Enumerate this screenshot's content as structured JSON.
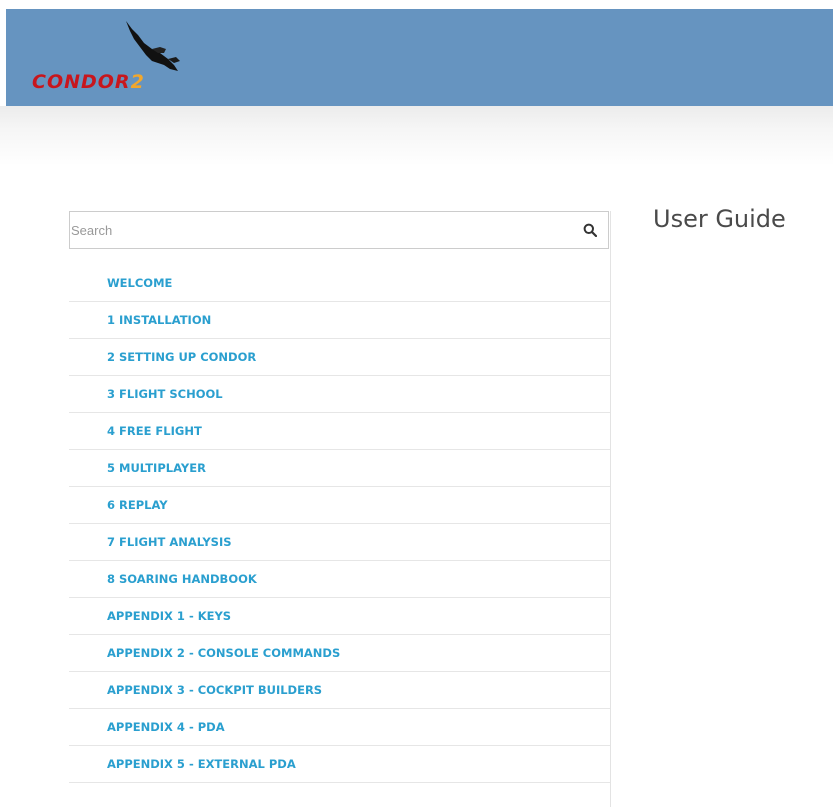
{
  "header": {
    "logo_text": "CONDOR",
    "logo_suffix": "2",
    "logo_icon": "condor-bird-icon",
    "background_color": "#6694c0",
    "logo_red": "#c8161d",
    "logo_orange": "#f2a72c"
  },
  "sidebar": {
    "search": {
      "placeholder": "Search",
      "value": "",
      "icon": "search-icon"
    },
    "link_color": "#2a9fcf",
    "items": [
      {
        "label": "WELCOME"
      },
      {
        "label": "1 INSTALLATION"
      },
      {
        "label": "2 SETTING UP CONDOR"
      },
      {
        "label": "3 FLIGHT SCHOOL"
      },
      {
        "label": "4 FREE FLIGHT"
      },
      {
        "label": "5 MULTIPLAYER"
      },
      {
        "label": "6 REPLAY"
      },
      {
        "label": "7 FLIGHT ANALYSIS"
      },
      {
        "label": "8 SOARING HANDBOOK"
      },
      {
        "label": "APPENDIX 1 - KEYS"
      },
      {
        "label": "APPENDIX 2 - CONSOLE COMMANDS"
      },
      {
        "label": "APPENDIX 3 - COCKPIT BUILDERS"
      },
      {
        "label": "APPENDIX 4 - PDA"
      },
      {
        "label": "APPENDIX 5 - EXTERNAL PDA"
      }
    ]
  },
  "main": {
    "title": "User Guide"
  }
}
